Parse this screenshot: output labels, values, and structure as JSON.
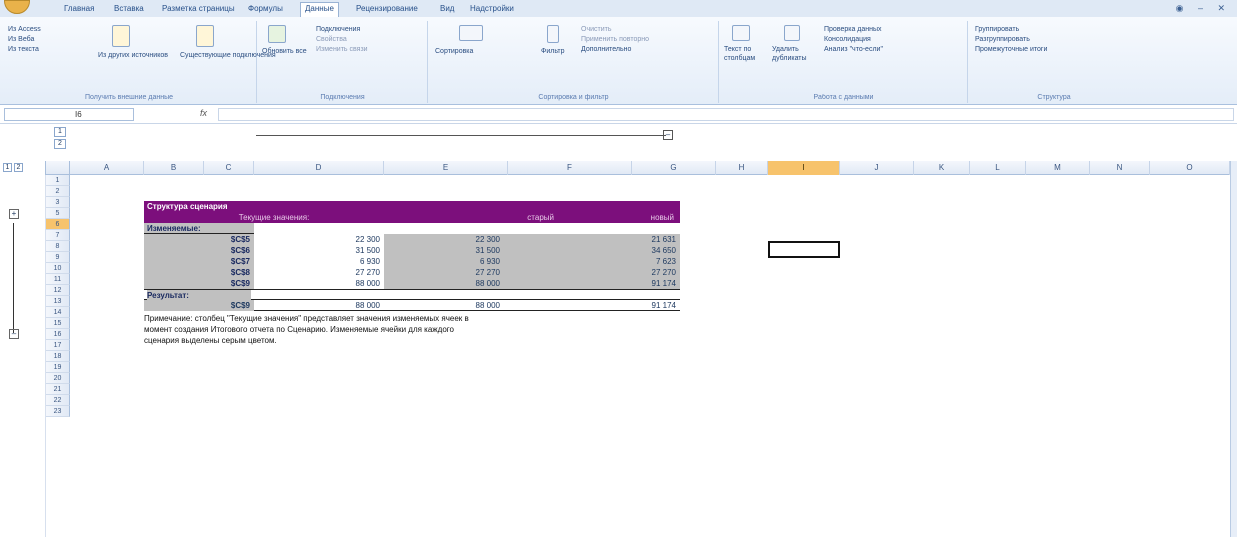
{
  "ribbon_tabs": [
    "Главная",
    "Вставка",
    "Разметка страницы",
    "Формулы",
    "Данные",
    "Рецензирование",
    "Вид",
    "Надстройки"
  ],
  "active_tab": "Данные",
  "groups": {
    "external": {
      "label": "Получить внешние данные",
      "items": [
        "Из Access",
        "Из Веба",
        "Из текста",
        "Из других источников",
        "Существующие подключения"
      ]
    },
    "connections": {
      "label": "Подключения",
      "items": [
        "Обновить все",
        "Подключения",
        "Свойства",
        "Изменить связи"
      ]
    },
    "sort": {
      "label": "Сортировка и фильтр",
      "items": [
        "Сортировка",
        "Фильтр",
        "Очистить",
        "Применить повторно",
        "Дополнительно"
      ]
    },
    "tools": {
      "label": "Работа с данными",
      "items": [
        "Текст по столбцам",
        "Удалить дубликаты",
        "Проверка данных",
        "Консолидация",
        "Анализ \"что-если\""
      ]
    },
    "outline": {
      "label": "Структура",
      "items": [
        "Группировать",
        "Разгруппировать",
        "Промежуточные итоги"
      ]
    }
  },
  "namebox": "I6",
  "fx": "fx",
  "columns": [
    "A",
    "B",
    "C",
    "D",
    "E",
    "F",
    "G",
    "H",
    "I",
    "J",
    "K",
    "L",
    "M",
    "N",
    "O"
  ],
  "selected_column": "I",
  "rows": [
    "1",
    "2",
    "3",
    "5",
    "6",
    "7",
    "8",
    "9",
    "10",
    "11",
    "12",
    "13",
    "14",
    "15",
    "16",
    "17",
    "18",
    "19",
    "20",
    "21",
    "22",
    "23"
  ],
  "selected_row": "6",
  "outline_levels": [
    "1",
    "2"
  ],
  "outline_row_levels": [
    "1",
    "2"
  ],
  "report": {
    "title": "Структура сценария",
    "head": [
      "Текущие значения:",
      "старый",
      "новый"
    ],
    "changing_label": "Изменяемые:",
    "changing": [
      {
        "cell": "$C$5",
        "vals": [
          "22 300",
          "22 300",
          "21 631"
        ]
      },
      {
        "cell": "$C$6",
        "vals": [
          "31 500",
          "31 500",
          "34 650"
        ]
      },
      {
        "cell": "$C$7",
        "vals": [
          "6 930",
          "6 930",
          "7 623"
        ]
      },
      {
        "cell": "$C$8",
        "vals": [
          "27 270",
          "27 270",
          "27 270"
        ]
      },
      {
        "cell": "$C$9",
        "vals": [
          "88 000",
          "88 000",
          "91 174"
        ]
      }
    ],
    "result_label": "Результат:",
    "result": {
      "cell": "$C$9",
      "vals": [
        "88 000",
        "88 000",
        "91 174"
      ]
    },
    "note": [
      "Примечание: столбец \"Текущие значения\" представляет значения изменяемых ячеек в",
      "момент создания Итогового отчета по Сценарию. Изменяемые ячейки для каждого",
      "сценария выделены серым цветом."
    ]
  },
  "colors": {
    "header": "#7c0f7c",
    "changing": "#c0c0c0",
    "selected": "#f7c36c"
  }
}
